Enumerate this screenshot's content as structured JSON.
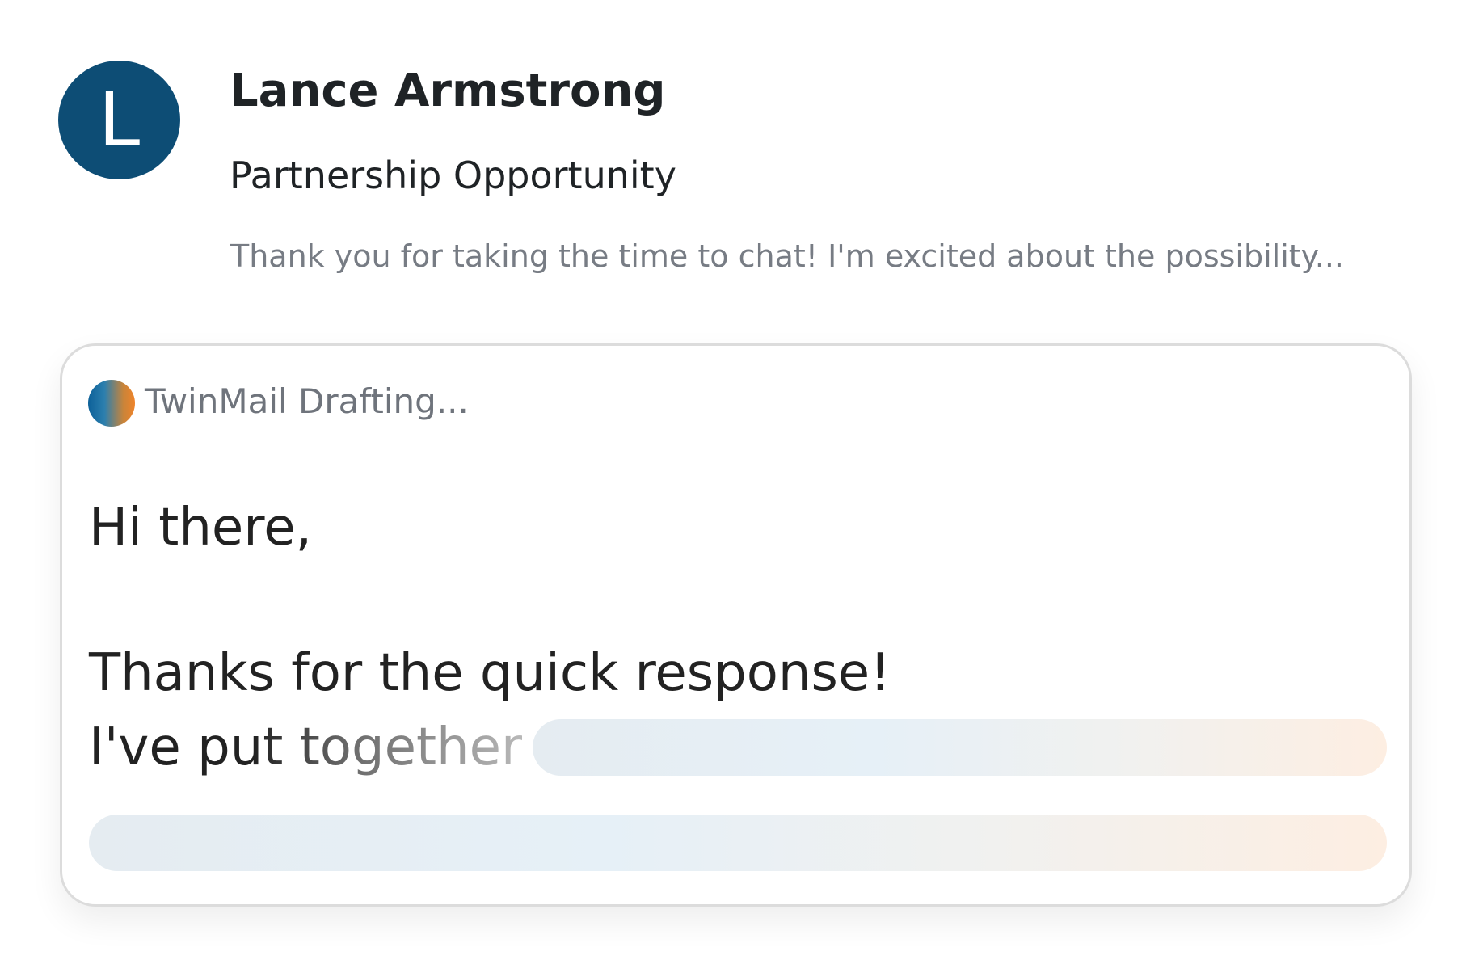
{
  "email": {
    "avatar_letter": "L",
    "sender_name": "Lance Armstrong",
    "subject": "Partnership Opportunity",
    "preview": "Thank you for taking the time to chat! I'm excited about the possibility..."
  },
  "draft": {
    "status_label": "TwinMail Drafting...",
    "greeting": "Hi there,",
    "line1": "Thanks for the quick response!",
    "line2": "I've put together"
  },
  "colors": {
    "avatar_bg": "#0d4d75",
    "brand_gradient_start": "#0d6199",
    "brand_gradient_end": "#f0842a",
    "muted_text": "#777c84"
  },
  "icons": {
    "brand": "twinmail-logo-icon"
  }
}
